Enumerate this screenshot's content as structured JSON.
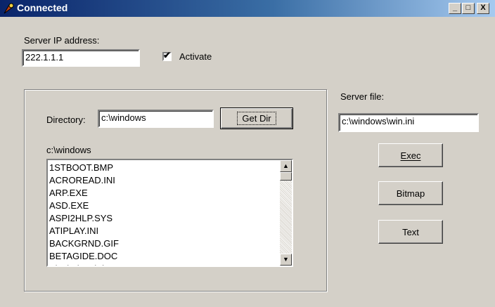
{
  "window": {
    "title": "Connected",
    "controls": {
      "minimize": "_",
      "maximize": "□",
      "close": "X"
    }
  },
  "server_ip": {
    "label": "Server IP address:",
    "value": "222.1.1.1"
  },
  "activate": {
    "label": "Activate",
    "checked": true,
    "mark": "✔"
  },
  "directory": {
    "label": "Directory:",
    "value": "c:\\windows",
    "button": "Get Dir"
  },
  "current_dir_label": "c:\\windows",
  "files": [
    "1STBOOT.BMP",
    "ACROREAD.INI",
    "ARP.EXE",
    "ASD.EXE",
    "ASPI2HLP.SYS",
    "ATIPLAY.INI",
    "BACKGRND.GIF",
    "BETAGIDE.DOC",
    "BlackThatch.bmp"
  ],
  "server_file": {
    "label": "Server file:",
    "value": "c:\\windows\\win.ini"
  },
  "buttons": {
    "exec": "Exec",
    "bitmap": "Bitmap",
    "text": "Text"
  },
  "scrollbar": {
    "up": "▲",
    "down": "▼"
  }
}
